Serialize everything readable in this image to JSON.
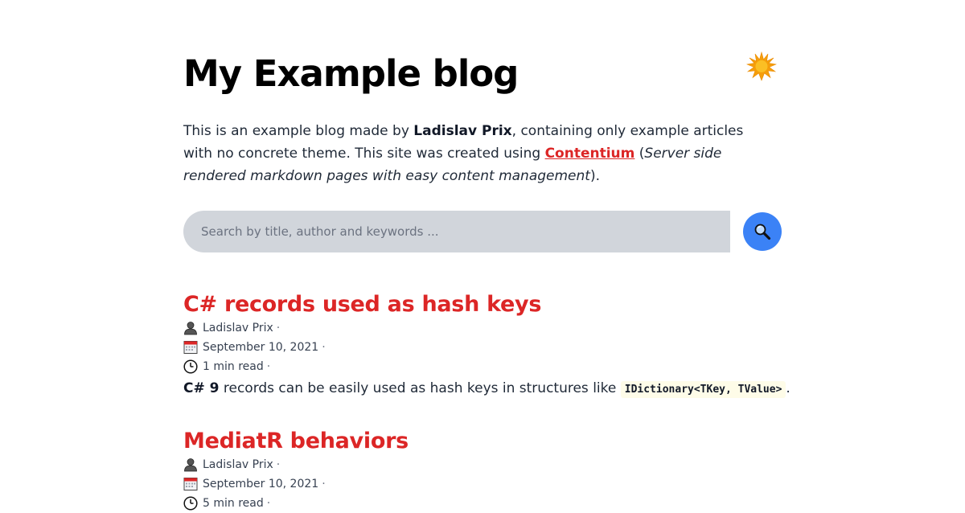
{
  "header": {
    "title": "My Example blog",
    "theme_toggle_icon": "sun-icon"
  },
  "intro": {
    "text_1": "This is an example blog made by ",
    "author": "Ladislav Prix",
    "text_2": ", containing only example articles with no concrete theme. This site was created using ",
    "link_label": "Contentium",
    "text_3": " (",
    "tagline": "Server side rendered markdown pages with easy content management",
    "text_4": ")."
  },
  "search": {
    "placeholder": "Search by title, author and keywords ...",
    "button_icon": "magnifier-icon"
  },
  "articles": [
    {
      "title": "C# records used as hash keys",
      "author": "Ladislav Prix",
      "date": "September 10, 2021",
      "read_time": "1 min read",
      "separator": "·",
      "excerpt_bold": "C# 9",
      "excerpt_text": " records can be easily used as hash keys in structures like ",
      "excerpt_code": "IDictionary<TKey, TValue>",
      "excerpt_end": "."
    },
    {
      "title": "MediatR behaviors",
      "author": "Ladislav Prix",
      "date": "September 10, 2021",
      "read_time": "5 min read",
      "separator": "·"
    }
  ],
  "colors": {
    "accent": "#dc2626",
    "search_button": "#3b82f6",
    "search_field": "#d1d5db",
    "sun": "#f59e0b"
  }
}
